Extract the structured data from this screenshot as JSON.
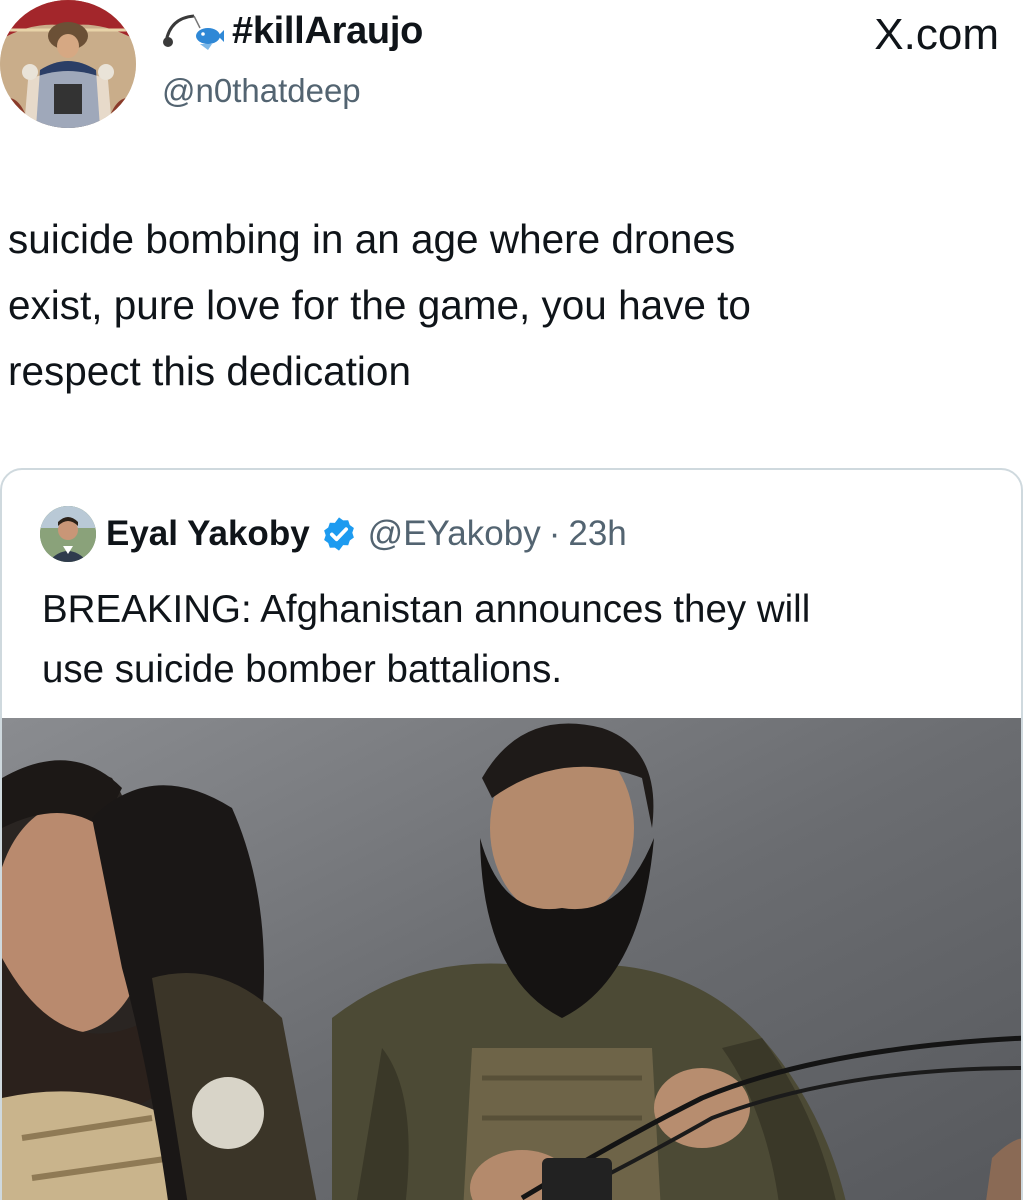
{
  "author": {
    "display_name": "#killAraujo",
    "handle": "@n0thatdeep",
    "name_icon": "fishing-rod-icon"
  },
  "site": {
    "label": "X.com"
  },
  "tweet": {
    "lines": [
      "suicide bombing in an age where drones",
      "exist, pure love for the game, you have to",
      "respect this dedication"
    ]
  },
  "quoted_tweet": {
    "display_name": "Eyal Yakoby",
    "verified_icon": "verified-badge-icon",
    "handle": "@EYakoby",
    "separator": "·",
    "time": "23h",
    "lines": [
      "BREAKING: Afghanistan announces they will",
      "use suicide bomber battalions."
    ],
    "media": "photo-of-armed-fighters"
  },
  "colors": {
    "text": "#0f1419",
    "secondary": "#536471",
    "border": "#cfd9de",
    "verified": "#1d9bf0"
  }
}
